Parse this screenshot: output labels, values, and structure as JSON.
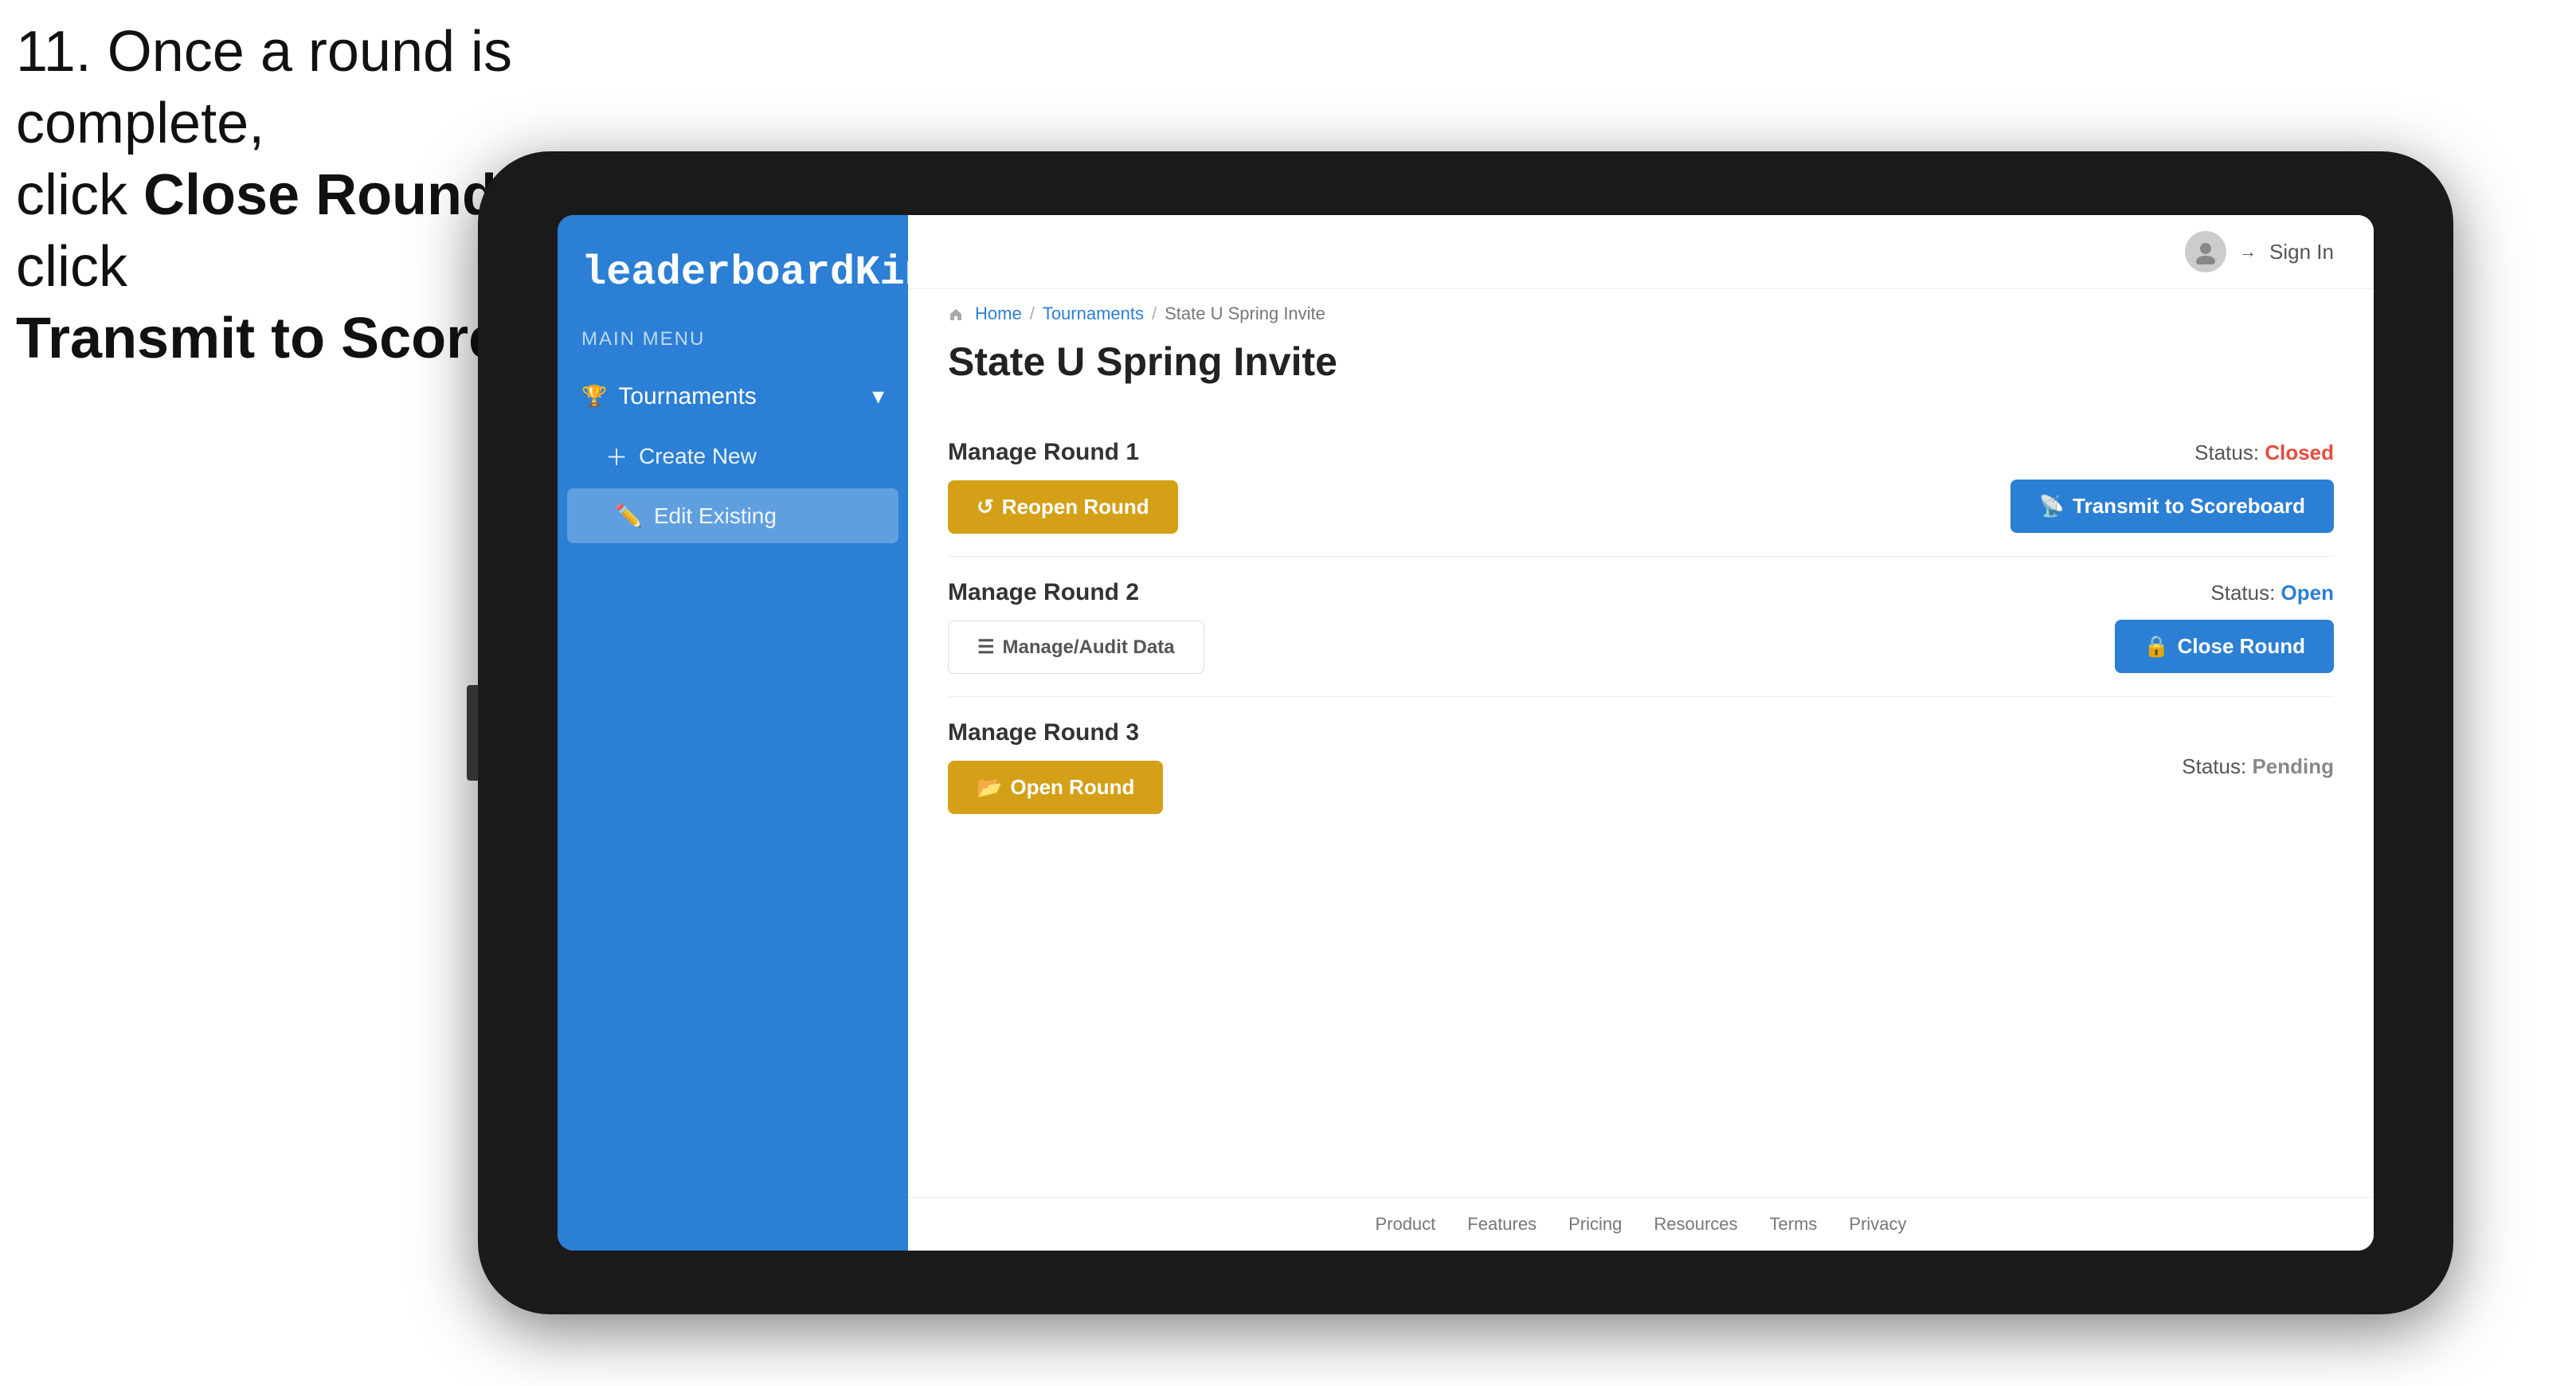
{
  "instruction": {
    "line1": "11. Once a round is complete,",
    "line2": "click ",
    "bold1": "Close Round",
    "line3": " then click",
    "bold2": "Transmit to Scoreboard."
  },
  "header": {
    "sign_in": "Sign In"
  },
  "breadcrumb": {
    "home": "Home",
    "sep1": "/",
    "tournaments": "Tournaments",
    "sep2": "/",
    "current": "State U Spring Invite"
  },
  "page": {
    "title": "State U Spring Invite"
  },
  "sidebar": {
    "logo": "leaderboard",
    "logo_bold": "King",
    "main_menu": "MAIN MENU",
    "nav": {
      "tournaments_label": "Tournaments",
      "create_new": "Create New",
      "edit_existing": "Edit Existing"
    }
  },
  "rounds": [
    {
      "id": "round1",
      "title": "Manage Round 1",
      "status_label": "Status:",
      "status_value": "Closed",
      "status_class": "closed",
      "primary_btn": "Reopen Round",
      "secondary_btn": "Transmit to Scoreboard"
    },
    {
      "id": "round2",
      "title": "Manage Round 2",
      "status_label": "Status:",
      "status_value": "Open",
      "status_class": "open",
      "primary_btn": "Manage/Audit Data",
      "secondary_btn": "Close Round"
    },
    {
      "id": "round3",
      "title": "Manage Round 3",
      "status_label": "Status:",
      "status_value": "Pending",
      "status_class": "pending",
      "primary_btn": "Open Round",
      "secondary_btn": null
    }
  ],
  "footer": {
    "links": [
      "Product",
      "Features",
      "Pricing",
      "Resources",
      "Terms",
      "Privacy"
    ]
  }
}
